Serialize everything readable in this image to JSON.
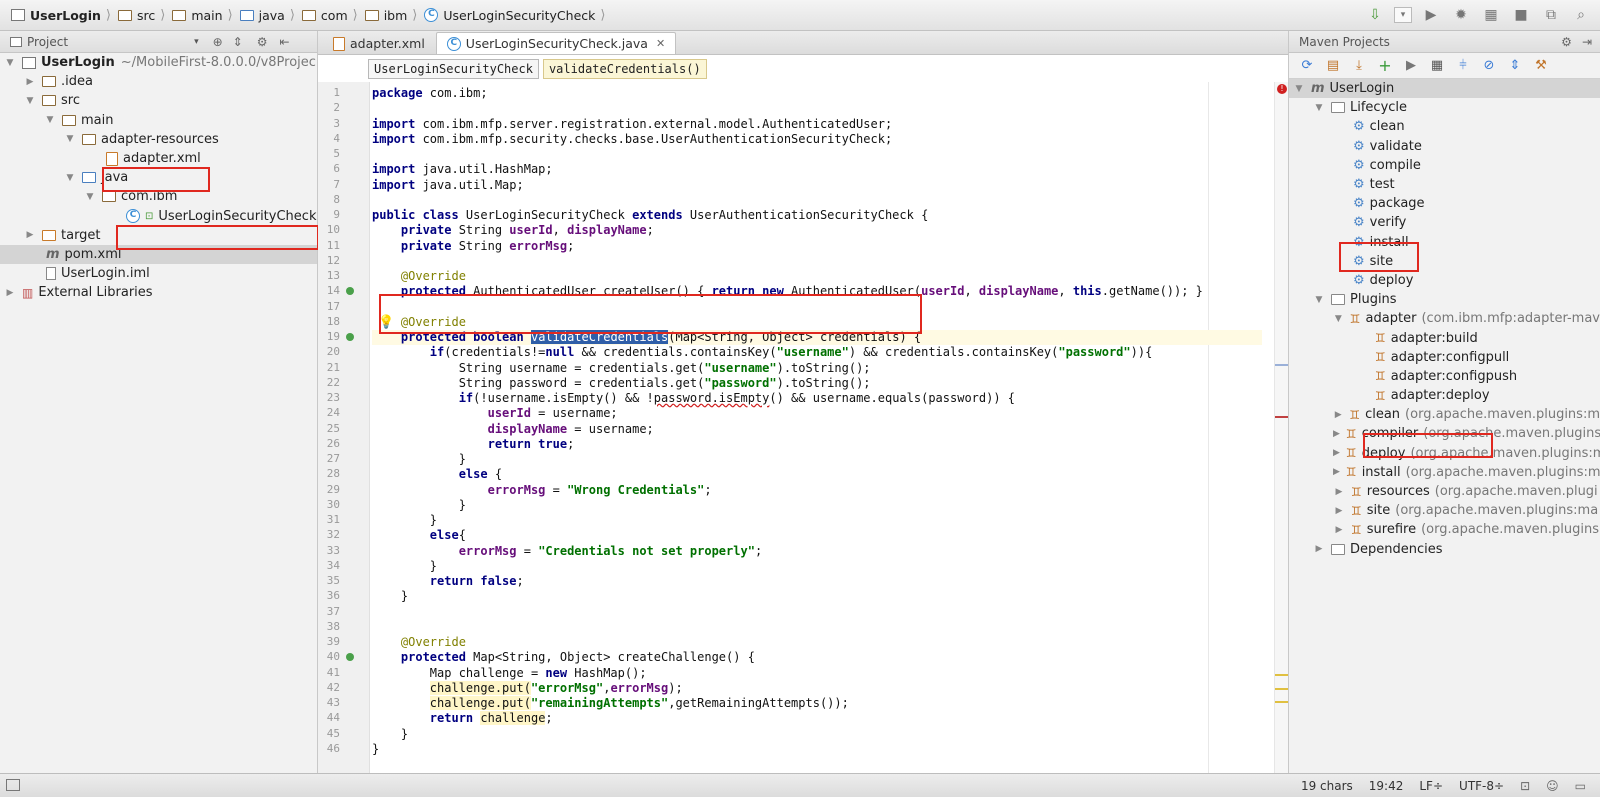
{
  "navbar": {
    "crumbs": [
      "UserLogin",
      "src",
      "main",
      "java",
      "com",
      "ibm",
      "UserLoginSecurityCheck"
    ]
  },
  "project_panel": {
    "title": "Project",
    "tree": [
      {
        "label": "UserLogin",
        "note": "~/MobileFirst-8.0.0.0/v8Projec"
      },
      {
        "label": ".idea"
      },
      {
        "label": "src"
      },
      {
        "label": "main"
      },
      {
        "label": "adapter-resources"
      },
      {
        "label": "adapter.xml"
      },
      {
        "label": "java"
      },
      {
        "label": "com.ibm"
      },
      {
        "label": "UserLoginSecurityCheck"
      },
      {
        "label": "target"
      },
      {
        "label": "pom.xml"
      },
      {
        "label": "UserLogin.iml"
      },
      {
        "label": "External Libraries"
      }
    ]
  },
  "editor": {
    "tabs": [
      "adapter.xml",
      "UserLoginSecurityCheck.java"
    ],
    "crumbs": [
      "UserLoginSecurityCheck",
      "validateCredentials()"
    ]
  },
  "maven": {
    "title": "Maven Projects",
    "root": "UserLogin",
    "lifecycle_label": "Lifecycle",
    "lifecycle": [
      "clean",
      "validate",
      "compile",
      "test",
      "package",
      "verify",
      "install",
      "site",
      "deploy"
    ],
    "plugins_label": "Plugins",
    "adapter_plugin": {
      "name": "adapter",
      "note": "(com.ibm.mfp:adapter-mav"
    },
    "adapter_goals": [
      "adapter:build",
      "adapter:configpull",
      "adapter:configpush",
      "adapter:deploy"
    ],
    "other_plugins": [
      {
        "name": "clean",
        "note": "(org.apache.maven.plugins:m"
      },
      {
        "name": "compiler",
        "note": "(org.apache.maven.plugins"
      },
      {
        "name": "deploy",
        "note": "(org.apache.maven.plugins:m"
      },
      {
        "name": "install",
        "note": "(org.apache.maven.plugins:m"
      },
      {
        "name": "resources",
        "note": "(org.apache.maven.plugi"
      },
      {
        "name": "site",
        "note": "(org.apache.maven.plugins:ma"
      },
      {
        "name": "surefire",
        "note": "(org.apache.maven.plugins"
      }
    ],
    "dependencies_label": "Dependencies"
  },
  "status": {
    "chars": "19 chars",
    "position": "19:42",
    "line_sep": "LF÷",
    "encoding": "UTF-8÷"
  },
  "code_lines": [
    {
      "n": "1",
      "html": "<span class='kw'>package</span> com.ibm;"
    },
    {
      "n": "2",
      "html": ""
    },
    {
      "n": "3",
      "html": "<span class='kw'>import</span> com.ibm.mfp.server.registration.external.model.AuthenticatedUser;"
    },
    {
      "n": "4",
      "html": "<span class='kw'>import</span> com.ibm.mfp.security.checks.base.UserAuthenticationSecurityCheck;"
    },
    {
      "n": "5",
      "html": ""
    },
    {
      "n": "6",
      "html": "<span class='kw'>import</span> java.util.HashMap;"
    },
    {
      "n": "7",
      "html": "<span class='kw'>import</span> java.util.Map;"
    },
    {
      "n": "8",
      "html": ""
    },
    {
      "n": "9",
      "html": "<span class='kw'>public class</span> UserLoginSecurityCheck <span class='kw'>extends</span> UserAuthenticationSecurityCheck {"
    },
    {
      "n": "10",
      "html": "    <span class='kw'>private</span> String <span class='fld'>userId</span>, <span class='fld'>displayName</span>;"
    },
    {
      "n": "11",
      "html": "    <span class='kw'>private</span> String <span class='fld'>errorMsg</span>;"
    },
    {
      "n": "12",
      "html": ""
    },
    {
      "n": "13",
      "html": "    <span class='ann'>@Override</span>"
    },
    {
      "n": "14",
      "html": "    <span class='kw'>protected</span> AuthenticatedUser createUser() { <span class='kw'>return new</span> AuthenticatedUser(<span class='fld'>userId</span>, <span class='fld'>displayName</span>, <span class='kw'>this</span>.getName()); }"
    },
    {
      "n": "17",
      "html": ""
    },
    {
      "n": "18",
      "html": "    <span class='ann'>@Override</span>"
    },
    {
      "n": "19",
      "html": "    <span class='kw'>protected boolean</span> <span class='sel-word'>validateCredentials</span>(Map&lt;String, Object&gt; credentials) {"
    },
    {
      "n": "20",
      "html": "        <span class='kw'>if</span>(credentials!=<span class='kw'>null</span> &amp;&amp; credentials.containsKey(<span class='str'>\"username\"</span>) &amp;&amp; credentials.containsKey(<span class='str'>\"password\"</span>)){"
    },
    {
      "n": "21",
      "html": "            String username = credentials.get(<span class='str'>\"username\"</span>).toString();"
    },
    {
      "n": "22",
      "html": "            String password = credentials.get(<span class='str'>\"password\"</span>).toString();"
    },
    {
      "n": "23",
      "html": "            <span class='kw'>if</span>(!username.isEmpty() &amp;&amp; !<span class='squig'>password.isEmpty</span>() &amp;&amp; username.equals(password)) {"
    },
    {
      "n": "24",
      "html": "                <span class='fld'>userId</span> = username;"
    },
    {
      "n": "25",
      "html": "                <span class='fld'>displayName</span> = username;"
    },
    {
      "n": "26",
      "html": "                <span class='kw'>return true</span>;"
    },
    {
      "n": "27",
      "html": "            }"
    },
    {
      "n": "28",
      "html": "            <span class='kw'>else</span> {"
    },
    {
      "n": "29",
      "html": "                <span class='fld'>errorMsg</span> = <span class='str'>\"Wrong Credentials\"</span>;"
    },
    {
      "n": "30",
      "html": "            }"
    },
    {
      "n": "31",
      "html": "        }"
    },
    {
      "n": "32",
      "html": "        <span class='kw'>else</span>{"
    },
    {
      "n": "33",
      "html": "            <span class='fld'>errorMsg</span> = <span class='str'>\"Credentials not set properly\"</span>;"
    },
    {
      "n": "34",
      "html": "        }"
    },
    {
      "n": "35",
      "html": "        <span class='kw'>return false</span>;"
    },
    {
      "n": "36",
      "html": "    }"
    },
    {
      "n": "37",
      "html": ""
    },
    {
      "n": "38",
      "html": ""
    },
    {
      "n": "39",
      "html": "    <span class='ann'>@Override</span>"
    },
    {
      "n": "40",
      "html": "    <span class='kw'>protected</span> Map&lt;String, Object&gt; createChallenge() {"
    },
    {
      "n": "41",
      "html": "        Map challenge = <span class='kw'>new</span> HashMap();"
    },
    {
      "n": "42",
      "html": "        <span class='yhl'>challenge.put(</span><span class='str'>\"errorMsg\"</span>,<span class='fld'>errorMsg</span>);"
    },
    {
      "n": "43",
      "html": "        <span class='yhl'>challenge.put(</span><span class='str'>\"remainingAttempts\"</span>,getRemainingAttempts());"
    },
    {
      "n": "44",
      "html": "        <span class='kw'>return</span> <span class='yhl'>challenge</span>;"
    },
    {
      "n": "45",
      "html": "    }"
    },
    {
      "n": "46",
      "html": "}"
    }
  ]
}
